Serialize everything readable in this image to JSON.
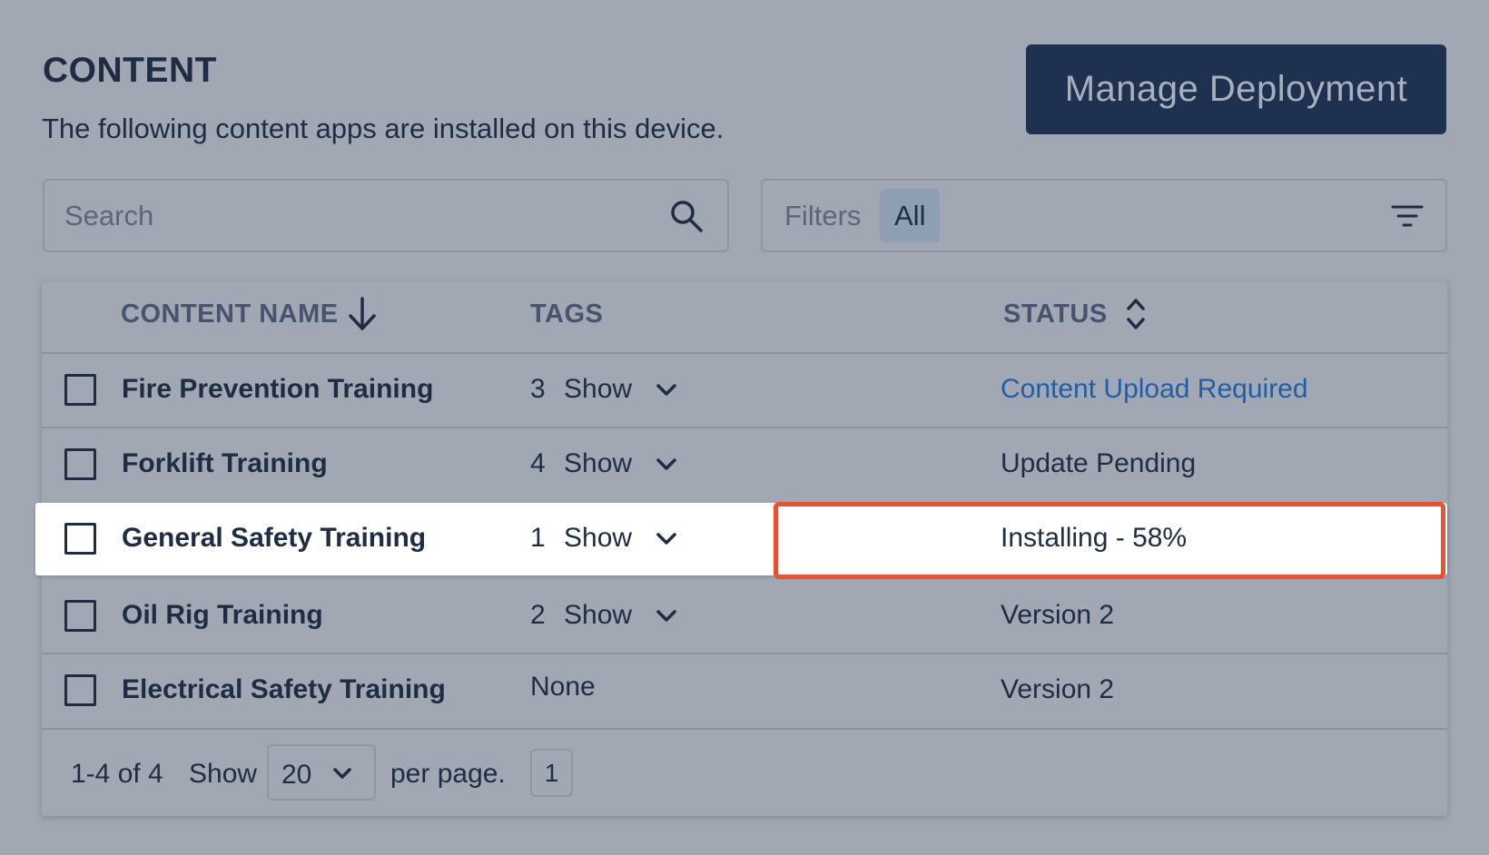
{
  "header": {
    "title": "CONTENT",
    "subtitle": "The following content apps are installed on this device.",
    "manage_button": "Manage Deployment"
  },
  "search": {
    "placeholder": "Search",
    "value": ""
  },
  "filters": {
    "label": "Filters",
    "selected": "All"
  },
  "table": {
    "columns": {
      "name": "CONTENT NAME",
      "tags": "TAGS",
      "status": "STATUS"
    },
    "show_label": "Show",
    "rows": [
      {
        "name": "Fire Prevention Training",
        "tag_count": "3",
        "status": "Content Upload Required"
      },
      {
        "name": "Forklift Training",
        "tag_count": "4",
        "status": "Update Pending"
      },
      {
        "name": "General Safety Training",
        "tag_count": "1",
        "status": "Installing - 58%"
      },
      {
        "name": "Oil Rig Training",
        "tag_count": "2",
        "status": "Version 2"
      },
      {
        "name": "Electrical Safety Training",
        "tags_none": "None",
        "status": "Version 2"
      }
    ],
    "install_progress": 0.58
  },
  "pagination": {
    "range": "1-4 of 4",
    "show_label": "Show",
    "per_page": "20",
    "per_page_suffix": "per page.",
    "current_page": "1"
  },
  "colors": {
    "background": "#a1a8b3",
    "primary_dark": "#1f3151",
    "link": "#1f5ea8",
    "highlight_border": "#e8522f"
  }
}
